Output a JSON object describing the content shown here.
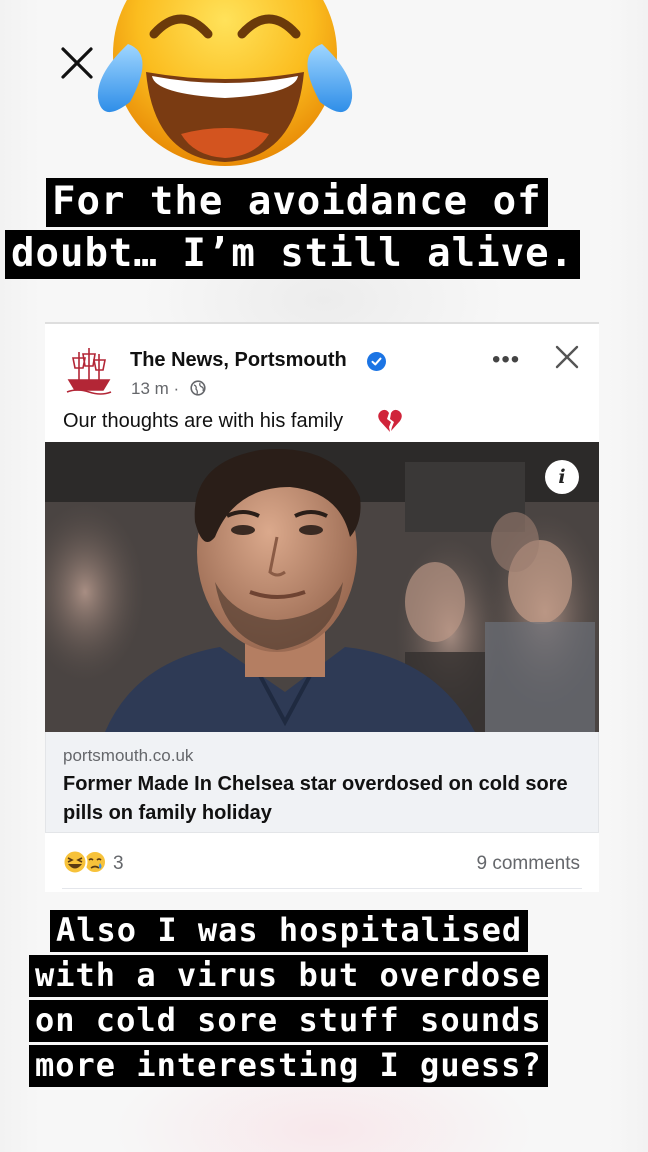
{
  "caption_top": {
    "line1": "For the avoidance of",
    "line2": "doubt… I’m still alive."
  },
  "post": {
    "page_name": "The News, Portsmouth",
    "time": "13 m ·",
    "text": "Our thoughts are with his family",
    "link_domain": "portsmouth.co.uk",
    "link_headline": "Former Made In Chelsea star overdosed on cold sore pills on family holiday",
    "reaction_count": "3",
    "comments": "9 comments",
    "more_label": "•••"
  },
  "caption_bottom": {
    "line1": "Also I was hospitalised",
    "line2": "with a virus but overdose",
    "line3": "on cold sore stuff sounds",
    "line4": "more interesting I guess?"
  },
  "icons": {
    "close": "close-icon",
    "emoji": "tears-of-joy-emoji",
    "verified": "verified-badge-icon",
    "globe": "globe-icon",
    "heart": "broken-heart-icon",
    "info": "info-icon",
    "reactions": [
      "laughing-reaction-icon",
      "sad-reaction-icon"
    ]
  },
  "colors": {
    "facebook_blue": "#1b74e4",
    "caption_bg": "#000000",
    "caption_text": "#ffffff",
    "heart": "#d0243a"
  }
}
